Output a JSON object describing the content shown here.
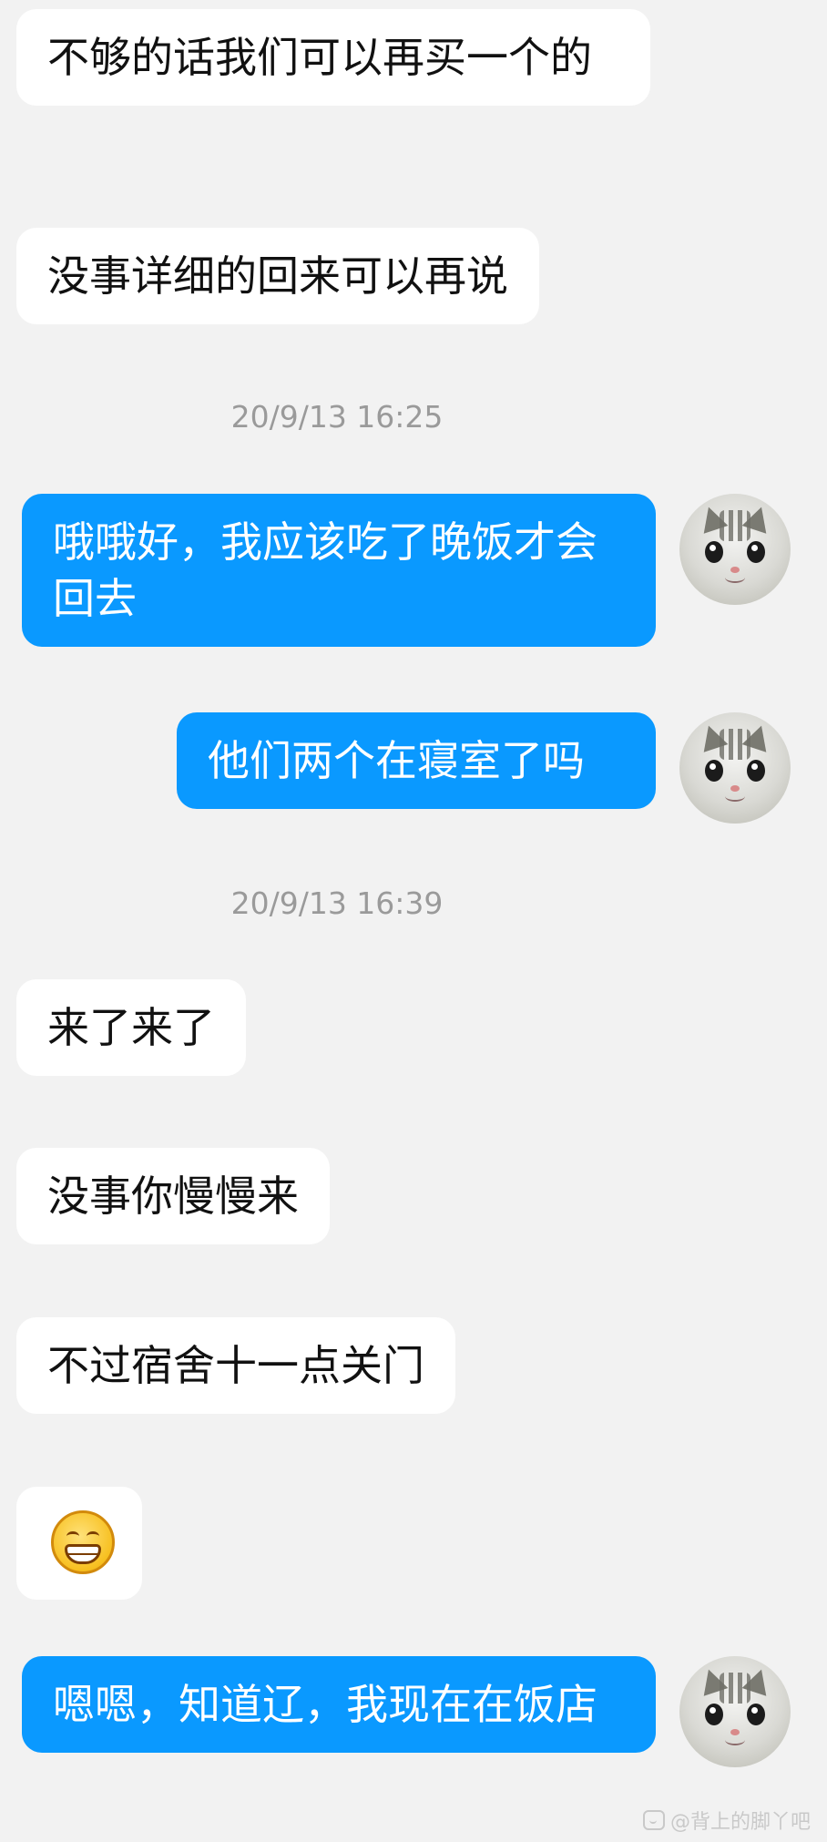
{
  "messages": [
    {
      "side": "in",
      "text": "不够的话我们可以再买一个的"
    },
    {
      "side": "in",
      "text": "没事详细的回来可以再说"
    },
    {
      "type": "time",
      "text": "20/9/13 16:25"
    },
    {
      "side": "out",
      "text": "哦哦好，我应该吃了晚饭才会回去"
    },
    {
      "side": "out",
      "text": "他们两个在寝室了吗"
    },
    {
      "type": "time",
      "text": "20/9/13 16:39"
    },
    {
      "side": "in",
      "text": "来了来了"
    },
    {
      "side": "in",
      "text": "没事你慢慢来"
    },
    {
      "side": "in",
      "text": "不过宿舍十一点关门"
    },
    {
      "side": "in",
      "sticker": "grinning-emoji"
    },
    {
      "side": "out",
      "text": "嗯嗯，知道辽，我现在在饭店"
    }
  ],
  "watermark": {
    "text": "@背上的脚丫吧"
  },
  "colors": {
    "background": "#f2f2f2",
    "incoming": "#ffffff",
    "outgoing": "#0a99ff",
    "timestamp": "#9a9a9a"
  }
}
